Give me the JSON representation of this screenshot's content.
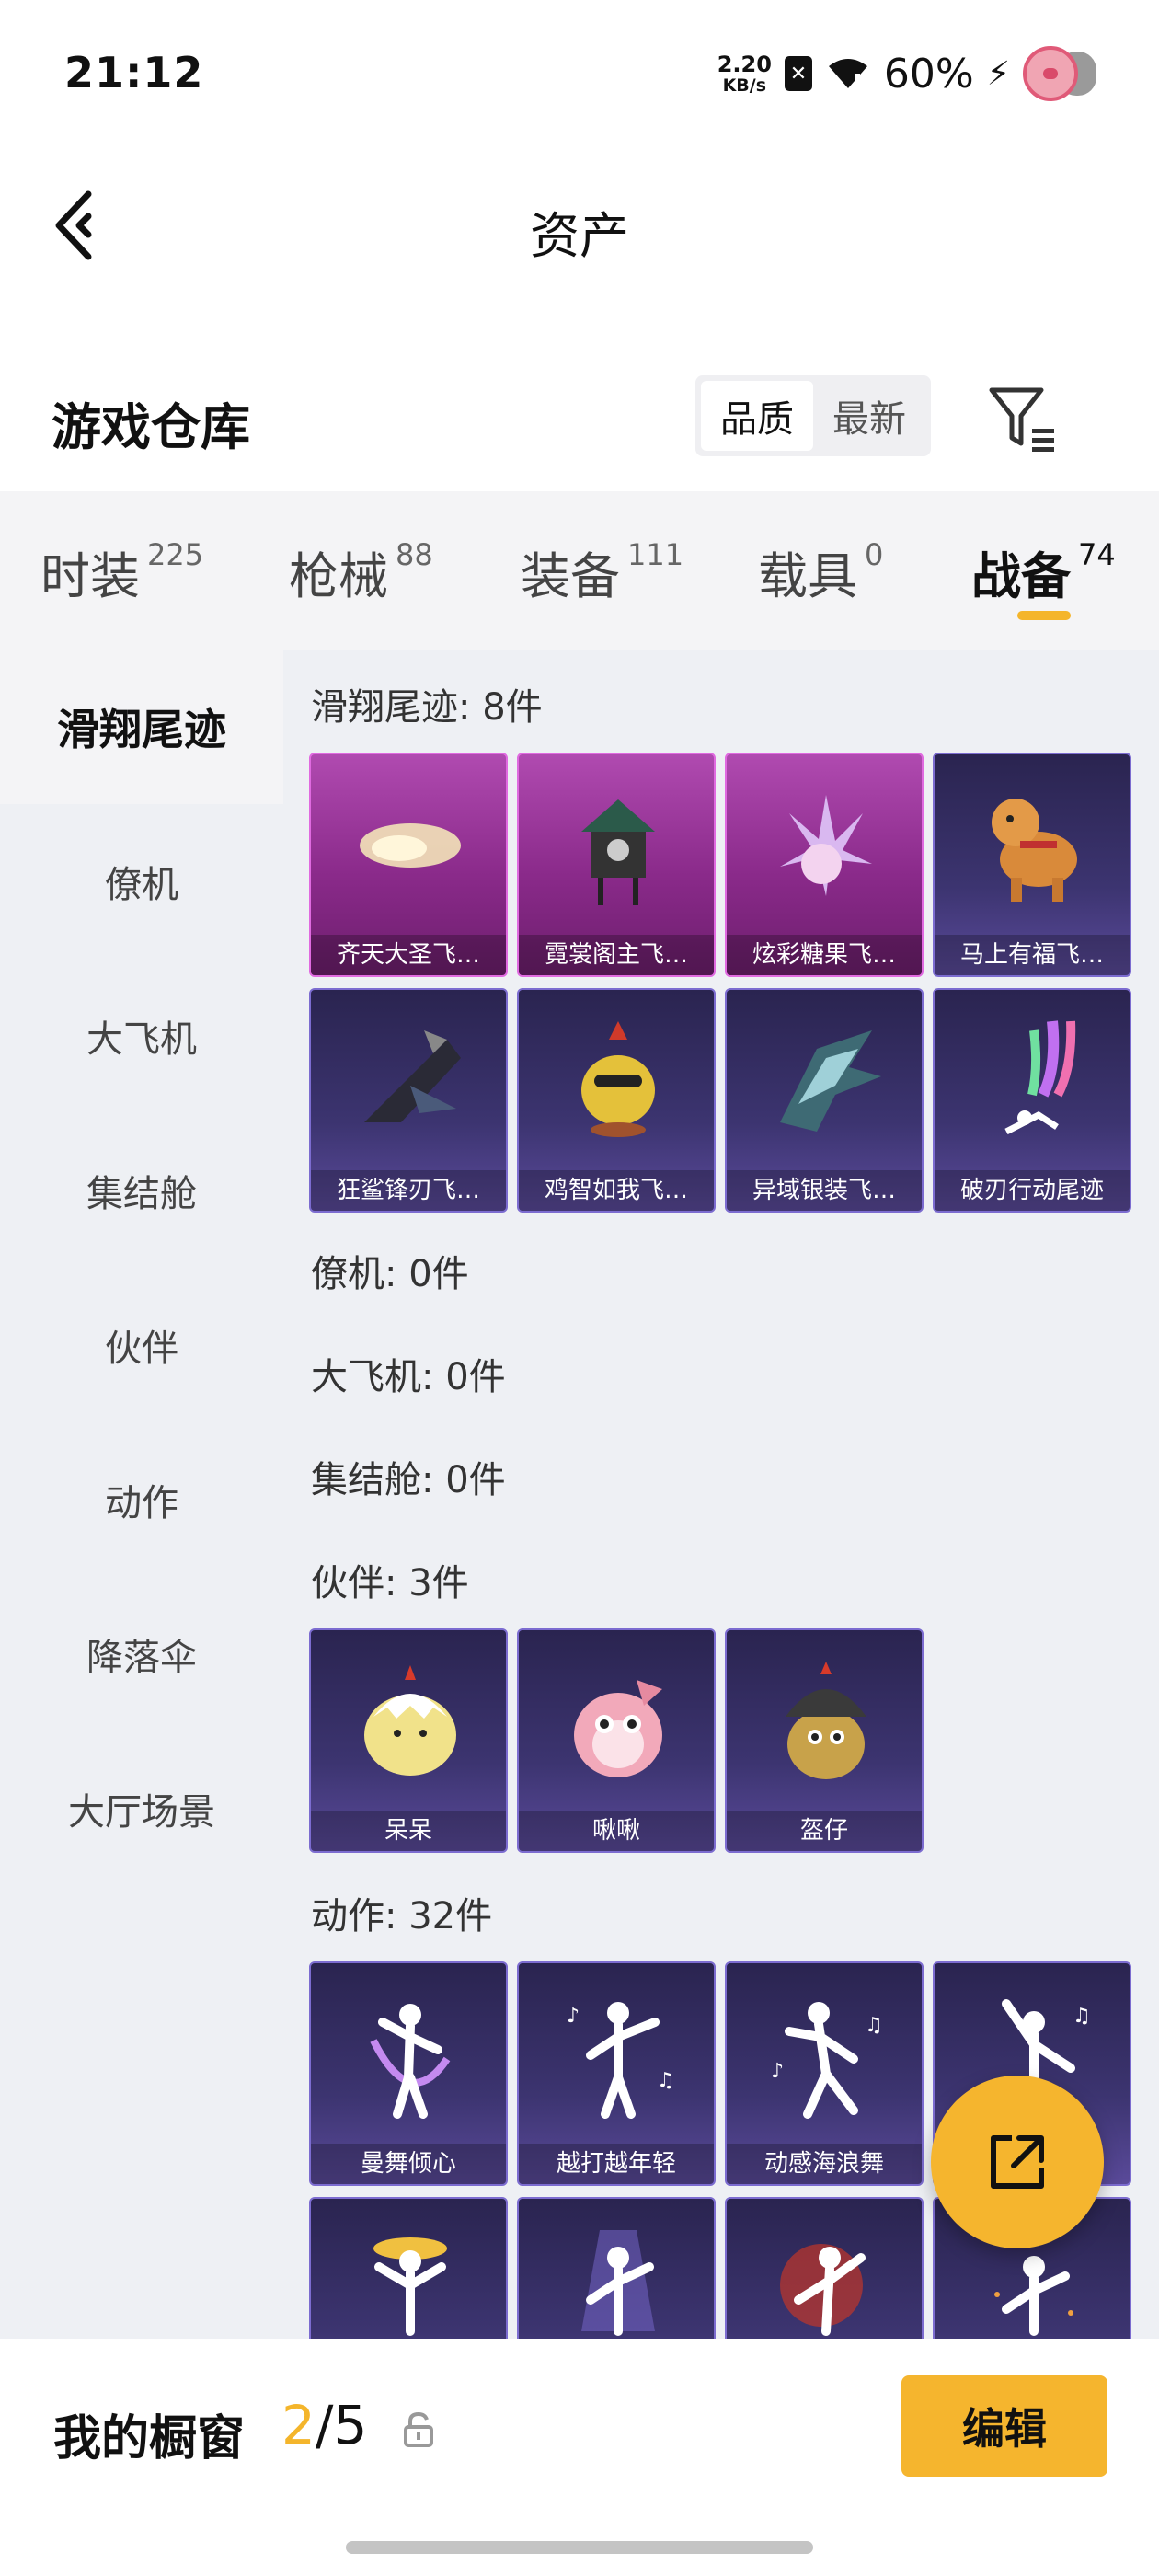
{
  "status_bar": {
    "time": "21:12",
    "net_speed_value": "2.20",
    "net_speed_unit": "KB/s",
    "battery": "60%"
  },
  "header": {
    "title": "资产"
  },
  "warehouse": {
    "title": "游戏仓库",
    "sort_options": [
      "品质",
      "最新"
    ],
    "sort_selected": "品质"
  },
  "tabs": [
    {
      "label": "时装",
      "count": "225"
    },
    {
      "label": "枪械",
      "count": "88"
    },
    {
      "label": "装备",
      "count": "111"
    },
    {
      "label": "载具",
      "count": "0"
    },
    {
      "label": "战备",
      "count": "74",
      "active": true
    }
  ],
  "sidebar": {
    "items": [
      "滑翔尾迹",
      "僚机",
      "大飞机",
      "集结舱",
      "伙伴",
      "动作",
      "降落伞",
      "大厅场景"
    ],
    "active": "滑翔尾迹"
  },
  "groups": {
    "trail": {
      "title": "滑翔尾迹: 8件",
      "items": [
        "齐天大圣飞…",
        "霓裳阁主飞…",
        "炫彩糖果飞…",
        "马上有福飞…",
        "狂鲨锋刃飞…",
        "鸡智如我飞…",
        "异域银装飞…",
        "破刃行动尾迹"
      ]
    },
    "wingman": {
      "title": "僚机: 0件"
    },
    "plane": {
      "title": "大飞机: 0件"
    },
    "pod": {
      "title": "集结舱: 0件"
    },
    "companion": {
      "title": "伙伴: 3件",
      "items": [
        "呆呆",
        "啾啾",
        "盔仔"
      ]
    },
    "emote": {
      "title": "动作: 32件",
      "items": [
        "曼舞倾心",
        "越打越年轻",
        "动感海浪舞"
      ]
    }
  },
  "showcase": {
    "label": "我的橱窗",
    "current": "2",
    "separator": "/",
    "total": "5",
    "edit_label": "编辑"
  }
}
